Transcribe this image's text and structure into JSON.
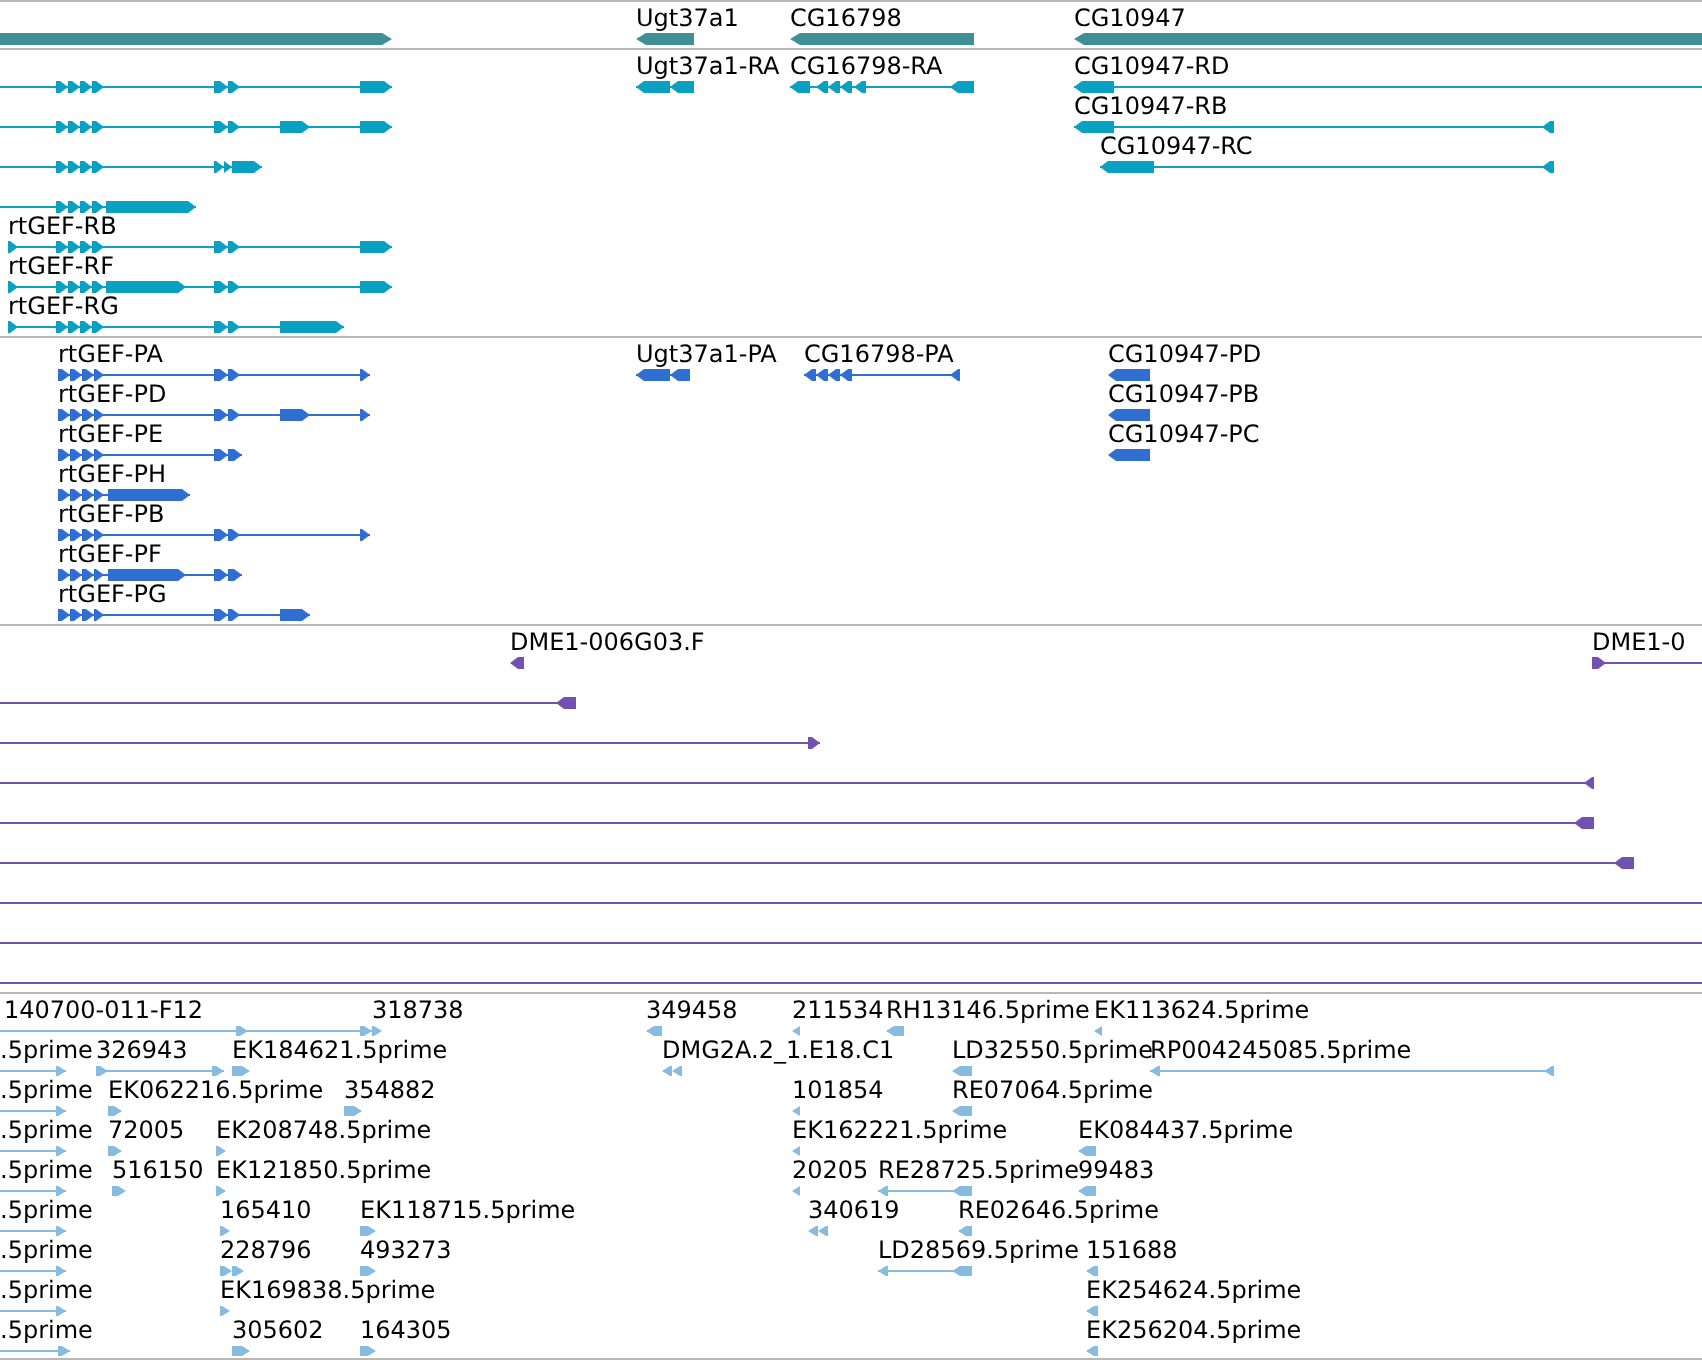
{
  "tracks": [
    {
      "kind": "gene",
      "color": "#3f8f95",
      "features": [
        {
          "reverse": false
        },
        {
          "label": "Ugt37a1",
          "reverse": true
        },
        {
          "label": "CG16798",
          "reverse": true
        },
        {
          "label": "CG10947",
          "reverse": true
        }
      ]
    },
    {
      "kind": "transcript",
      "color": "#0aa0c2",
      "features": [
        {
          "reverse": false
        },
        {
          "label": "Ugt37a1-RA",
          "reverse": true
        },
        {
          "label": "CG16798-RA",
          "reverse": true
        },
        {
          "label": "CG10947-RD",
          "reverse": true
        },
        {
          "reverse": false
        },
        {
          "label": "CG10947-RB",
          "reverse": true
        },
        {
          "reverse": false
        },
        {
          "label": "CG10947-RC",
          "reverse": true
        },
        {
          "reverse": false
        },
        {
          "label": "rtGEF-RB",
          "reverse": false
        },
        {
          "label": "rtGEF-RF",
          "reverse": false
        },
        {
          "label": "rtGEF-RG",
          "reverse": false
        }
      ]
    },
    {
      "kind": "protein",
      "color": "#306ed2",
      "features": [
        {
          "label": "rtGEF-PA",
          "reverse": false
        },
        {
          "label": "Ugt37a1-PA",
          "reverse": true
        },
        {
          "label": "CG16798-PA",
          "reverse": true
        },
        {
          "label": "CG10947-PD",
          "reverse": true
        },
        {
          "label": "rtGEF-PD",
          "reverse": false
        },
        {
          "label": "CG10947-PB",
          "reverse": true
        },
        {
          "label": "rtGEF-PE",
          "reverse": false
        },
        {
          "label": "CG10947-PC",
          "reverse": true
        },
        {
          "label": "rtGEF-PH",
          "reverse": false
        },
        {
          "label": "rtGEF-PB",
          "reverse": false
        },
        {
          "label": "rtGEF-PF",
          "reverse": false
        },
        {
          "label": "rtGEF-PG",
          "reverse": false
        }
      ]
    },
    {
      "kind": "alignment",
      "color": "#7252b0",
      "features": [
        {
          "label": "DME1-006G03.F",
          "reverse": true,
          "clipped_right": false
        },
        {
          "label": "DME1-0",
          "reverse": false,
          "clipped_right": true
        },
        {
          "reverse": true,
          "clipped_right": false
        },
        {
          "reverse": false,
          "clipped_right": false
        },
        {
          "reverse": true,
          "clipped_right": false
        },
        {
          "reverse": true,
          "clipped_right": false
        },
        {
          "reverse": true,
          "clipped_right": false
        },
        {
          "clipped_right": true
        },
        {
          "clipped_right": true
        },
        {
          "clipped_right": true
        }
      ]
    },
    {
      "kind": "est",
      "color": "#88bbe0",
      "features": [
        {
          "label": "140700-011-F12",
          "reverse": false
        },
        {
          "label": "318738",
          "reverse": false
        },
        {
          "label": "349458",
          "reverse": true
        },
        {
          "label": "211534",
          "reverse": true
        },
        {
          "label": "RH13146.5prime",
          "reverse": true
        },
        {
          "label": "EK113624.5prime",
          "reverse": true
        },
        {
          "label": ".5prime",
          "reverse": false
        },
        {
          "label": "326943",
          "reverse": false
        },
        {
          "label": "EK184621.5prime",
          "reverse": false
        },
        {
          "label": "DMG2A.2_1.E18.C1",
          "reverse": true
        },
        {
          "label": "LD32550.5prime",
          "reverse": true
        },
        {
          "label": "RP004245085.5prime",
          "reverse": true
        },
        {
          "label": ".5prime",
          "reverse": false
        },
        {
          "label": "EK062216.5prime",
          "reverse": false
        },
        {
          "label": "354882",
          "reverse": false
        },
        {
          "label": "101854",
          "reverse": true
        },
        {
          "label": "RE07064.5prime",
          "reverse": true
        },
        {
          "label": ".5prime",
          "reverse": false
        },
        {
          "label": "72005",
          "reverse": false
        },
        {
          "label": "EK208748.5prime",
          "reverse": false
        },
        {
          "label": "EK162221.5prime",
          "reverse": true
        },
        {
          "label": "EK084437.5prime",
          "reverse": true
        },
        {
          "label": ".5prime",
          "reverse": false
        },
        {
          "label": "516150",
          "reverse": false
        },
        {
          "label": "EK121850.5prime",
          "reverse": false
        },
        {
          "label": "20205",
          "reverse": true
        },
        {
          "label": "RE28725.5prime",
          "reverse": true
        },
        {
          "label": "99483",
          "reverse": true
        },
        {
          "label": ".5prime",
          "reverse": false
        },
        {
          "label": "165410",
          "reverse": false
        },
        {
          "label": "EK118715.5prime",
          "reverse": false
        },
        {
          "label": "340619",
          "reverse": true
        },
        {
          "label": "RE02646.5prime",
          "reverse": true
        },
        {
          "label": ".5prime",
          "reverse": false
        },
        {
          "label": "228796",
          "reverse": false
        },
        {
          "label": "493273",
          "reverse": false
        },
        {
          "label": "LD28569.5prime",
          "reverse": true
        },
        {
          "label": "151688",
          "reverse": true
        },
        {
          "label": ".5prime",
          "reverse": false
        },
        {
          "label": "EK169838.5prime",
          "reverse": false
        },
        {
          "label": "EK254624.5prime",
          "reverse": true
        },
        {
          "label": ".5prime",
          "reverse": false
        },
        {
          "label": "305602",
          "reverse": false
        },
        {
          "label": "164305",
          "reverse": false
        },
        {
          "label": "EK256204.5prime",
          "reverse": true
        }
      ]
    }
  ]
}
